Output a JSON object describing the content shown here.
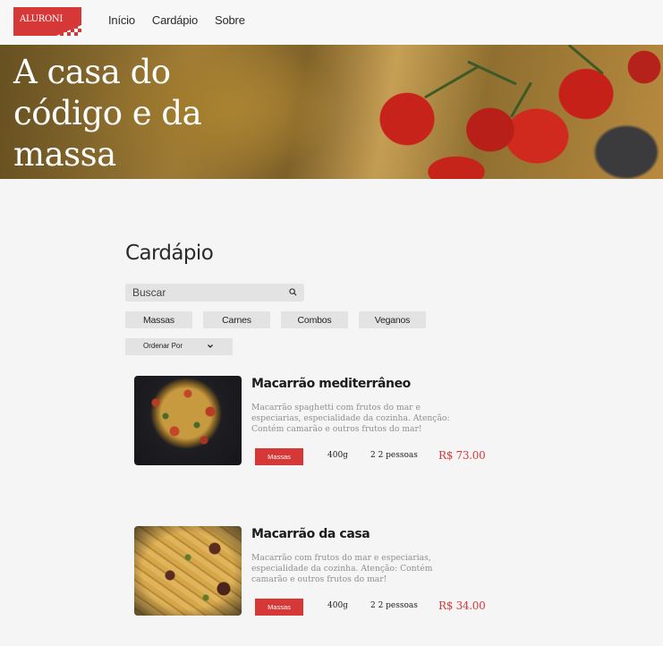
{
  "brand": {
    "logo_text": "ALURONI",
    "accent_color": "#d63838"
  },
  "nav": {
    "items": [
      "Início",
      "Cardápio",
      "Sobre"
    ]
  },
  "hero": {
    "title": "A casa do código e da massa"
  },
  "menu": {
    "title": "Cardápio",
    "search_placeholder": "Buscar",
    "search_icon": "search-icon",
    "filters": [
      "Massas",
      "Carnes",
      "Combos",
      "Veganos"
    ],
    "sort_label": "Ordenar Por",
    "sort_icon": "chevron-down-icon"
  },
  "dishes": [
    {
      "name": "Macarrão mediterrâneo",
      "description": "Macarrão spaghetti com frutos do mar e especiarias, especialidade da cozinha. Atenção: Contém camarão e outros frutos do mar!",
      "category": "Massas",
      "weight": "400g",
      "serves": "2 2 pessoas",
      "price": "R$ 73.00"
    },
    {
      "name": "Macarrão da casa",
      "description": "Macarrão com frutos do mar e especiarias, especialidade da cozinha. Atenção: Contém camarão e outros frutos do mar!",
      "category": "Massas",
      "weight": "400g",
      "serves": "2 2 pessoas",
      "price": "R$ 34.00"
    }
  ]
}
